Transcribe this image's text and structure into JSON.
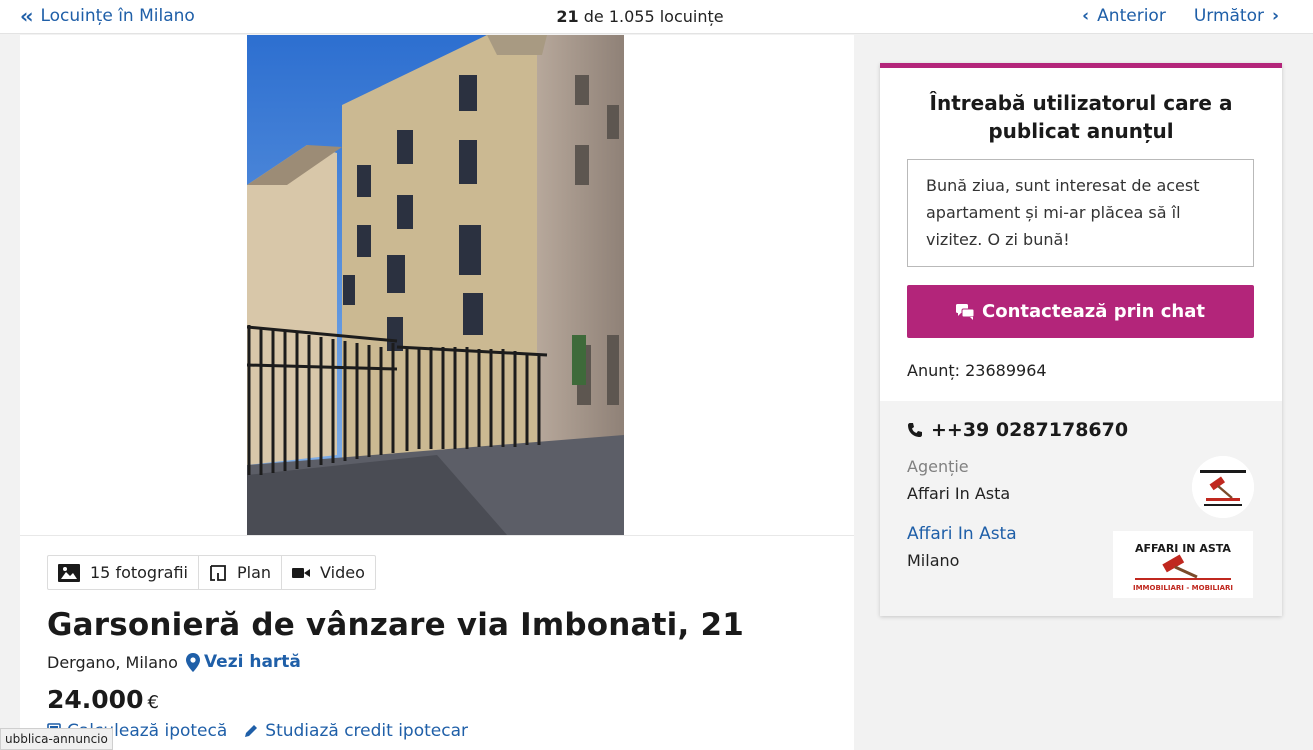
{
  "nav": {
    "back_label": "Locuințe în Milano",
    "counter_current": "21",
    "counter_rest": "de 1.055 locuințe",
    "prev_label": "Anterior",
    "next_label": "Următor"
  },
  "media": {
    "photos_label": "15 fotografii",
    "plan_label": "Plan",
    "video_label": "Video"
  },
  "listing": {
    "title": "Garsonieră de vânzare via Imbonati, 21",
    "location": "Dergano, Milano",
    "map_label": "Vezi hartă",
    "price": "24.000",
    "currency": "€",
    "mortgage_calc_label": "Calculează ipotecă",
    "mortgage_study_label": "Studiază credit ipotecar"
  },
  "contact": {
    "title": "Întreabă utilizatorul care a publicat anunțul",
    "message": "Bună ziua, sunt interesat de acest apartament și mi-ar plăcea să îl vizitez. O zi bună!",
    "chat_button_label": "Contactează prin chat",
    "ad_id_label": "Anunț: 23689964",
    "phone": "++39 0287178670",
    "agency_label": "Agenție",
    "agency_name": "Affari In Asta",
    "agency_link": "Affari In Asta",
    "agency_city": "Milano",
    "logo_text_top": "AFFARI IN ASTA",
    "logo_text_bottom": "IMMOBILIARI - MOBILIARI"
  },
  "status_bar": {
    "url_fragment": "ubblica-annuncio"
  },
  "colors": {
    "accent": "#b3257a",
    "link": "#1f5fa8"
  }
}
